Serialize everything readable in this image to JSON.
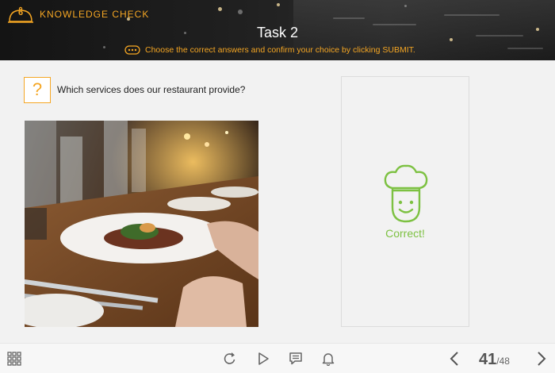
{
  "header": {
    "section_number": "6",
    "section_title": "KNOWLEDGE CHECK",
    "task_title": "Task 2",
    "instruction": "Choose the correct answers and confirm your choice by clicking SUBMIT."
  },
  "question": {
    "icon": "?",
    "text": "Which services does our restaurant provide?"
  },
  "feedback": {
    "icon": "chef-icon",
    "label": "Correct!"
  },
  "toolbar": {
    "menu_icon": "grid-icon",
    "replay_icon": "replay-icon",
    "play_icon": "play-icon",
    "notes_icon": "comment-icon",
    "notification_icon": "bell-icon",
    "prev_icon": "chevron-left-icon",
    "next_icon": "chevron-right-icon",
    "current_page": "41",
    "total_pages": "/48"
  },
  "colors": {
    "accent": "#f5a623",
    "success": "#7dc142",
    "header_bg": "#1f1f1f",
    "background": "#f2f2f2"
  }
}
